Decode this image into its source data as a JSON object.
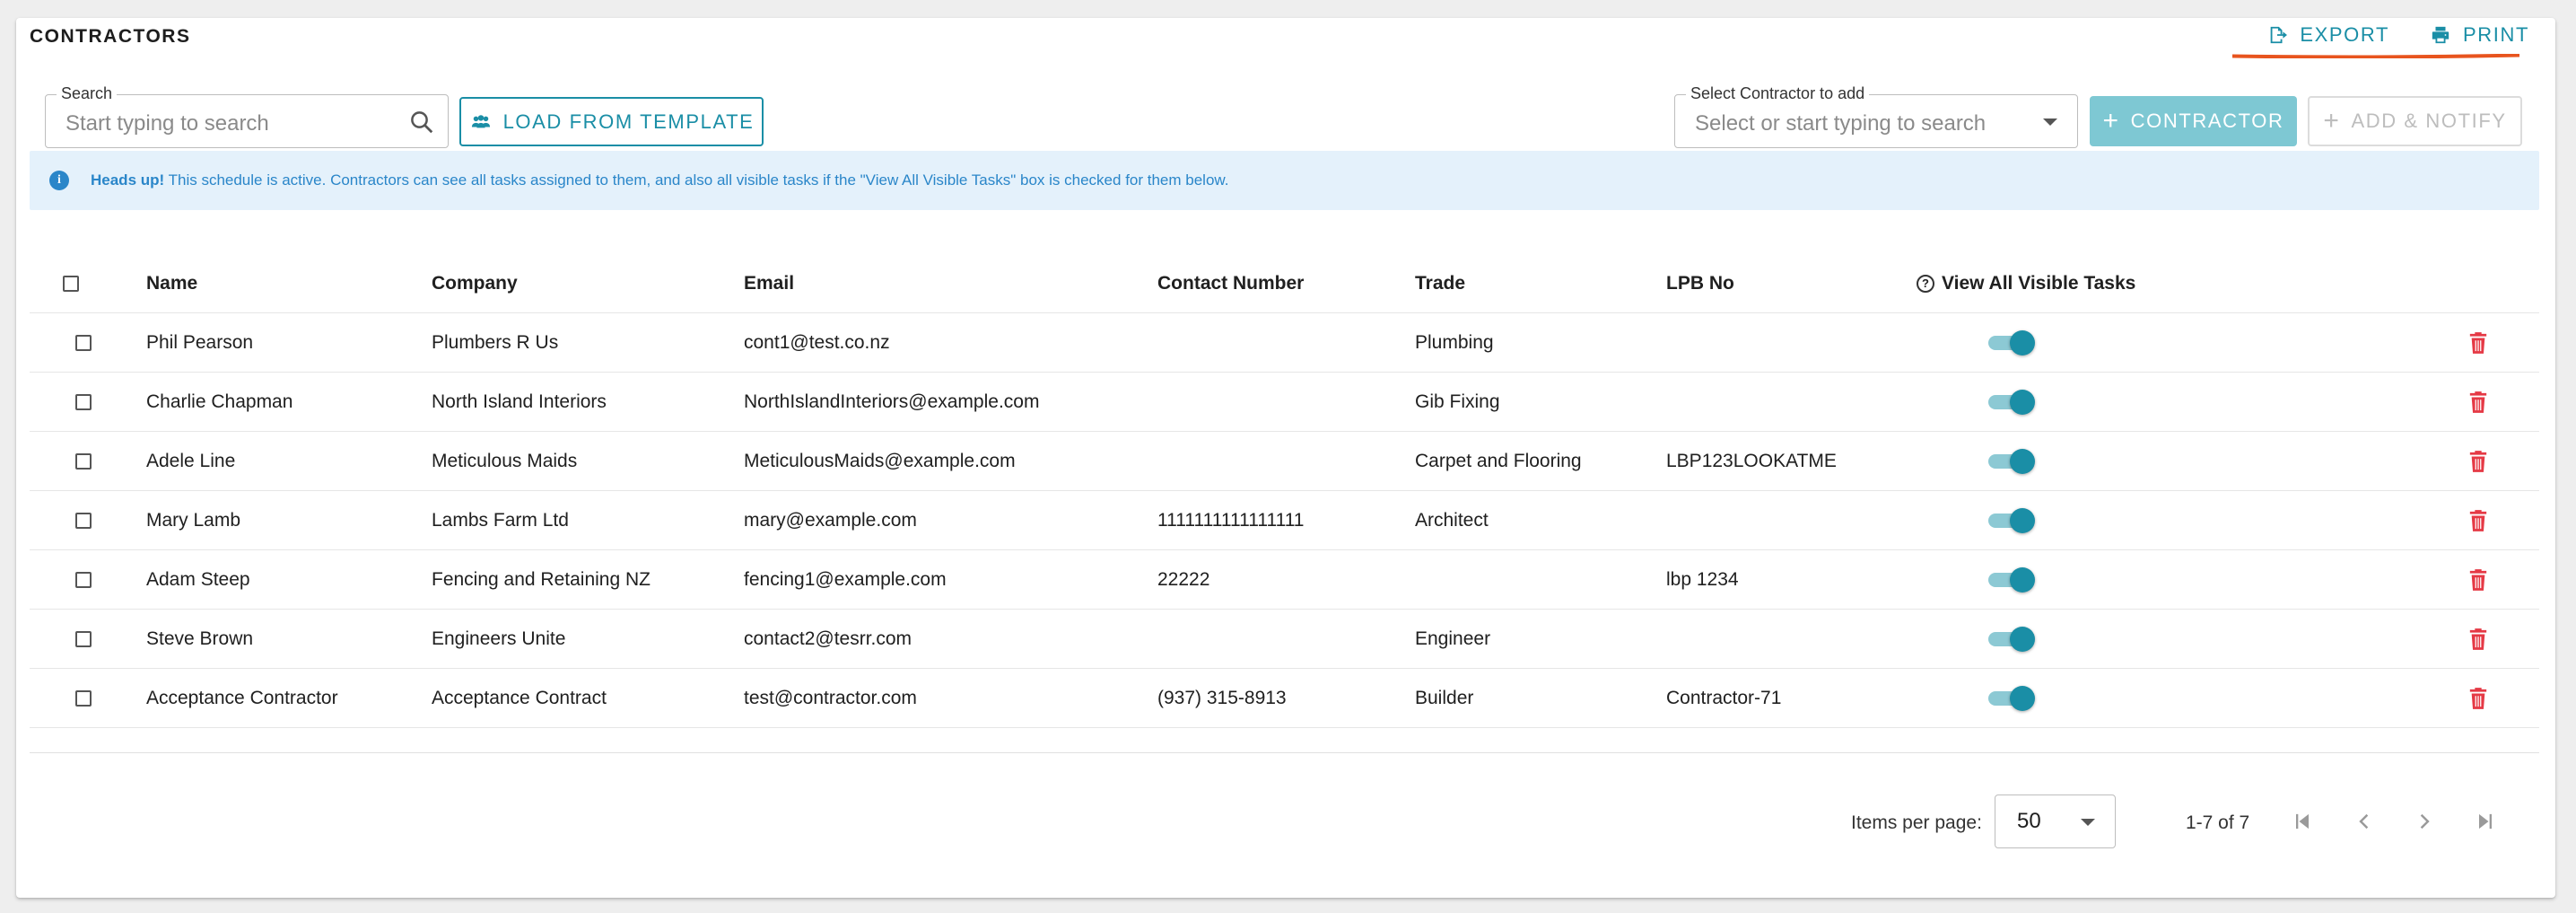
{
  "title": "CONTRACTORS",
  "top_actions": {
    "export_label": "EXPORT",
    "print_label": "PRINT"
  },
  "search": {
    "label": "Search",
    "placeholder": "Start typing to search"
  },
  "load_template_label": "LOAD FROM TEMPLATE",
  "select_contractor": {
    "label": "Select Contractor to add",
    "placeholder": "Select or start typing to search"
  },
  "add_contractor_label": "CONTRACTOR",
  "add_notify_label": "ADD & NOTIFY",
  "banner": {
    "bold": "Heads up!",
    "text": "This schedule is active. Contractors can see all tasks assigned to them, and also all visible tasks if the \"View All Visible Tasks\" box is checked for them below."
  },
  "table": {
    "headers": {
      "name": "Name",
      "company": "Company",
      "email": "Email",
      "contact": "Contact Number",
      "trade": "Trade",
      "lpb": "LPB No",
      "visible": "View All Visible Tasks"
    },
    "rows": [
      {
        "name": "Phil Pearson",
        "company": "Plumbers R Us",
        "email": "cont1@test.co.nz",
        "contact": "",
        "trade": "Plumbing",
        "lpb": "",
        "visible": true
      },
      {
        "name": "Charlie Chapman",
        "company": "North Island Interiors",
        "email": "NorthIslandInteriors@example.com",
        "contact": "",
        "trade": "Gib Fixing",
        "lpb": "",
        "visible": true
      },
      {
        "name": "Adele Line",
        "company": "Meticulous Maids",
        "email": "MeticulousMaids@example.com",
        "contact": "",
        "trade": "Carpet and Flooring",
        "lpb": "LBP123LOOKATME",
        "visible": true
      },
      {
        "name": "Mary Lamb",
        "company": "Lambs Farm Ltd",
        "email": "mary@example.com",
        "contact": "1111111111111111",
        "trade": "Architect",
        "lpb": "",
        "visible": true
      },
      {
        "name": "Adam Steep",
        "company": "Fencing and Retaining NZ",
        "email": "fencing1@example.com",
        "contact": "22222",
        "trade": "",
        "lpb": "lbp 1234",
        "visible": true
      },
      {
        "name": "Steve Brown",
        "company": "Engineers Unite",
        "email": "contact2@tesrr.com",
        "contact": "",
        "trade": "Engineer",
        "lpb": "",
        "visible": true
      },
      {
        "name": "Acceptance Contractor",
        "company": "Acceptance Contract",
        "email": "test@contractor.com",
        "contact": "(937) 315-8913",
        "trade": "Builder",
        "lpb": "Contractor-71",
        "visible": true
      }
    ]
  },
  "pagination": {
    "items_label": "Items per page:",
    "per_page": "50",
    "range": "1-7 of 7"
  },
  "colors": {
    "accent": "#1a8ea6",
    "danger": "#e53945",
    "info_bg": "#e4f1fb",
    "info_text": "#2a86c9",
    "underline": "#e8541e"
  }
}
